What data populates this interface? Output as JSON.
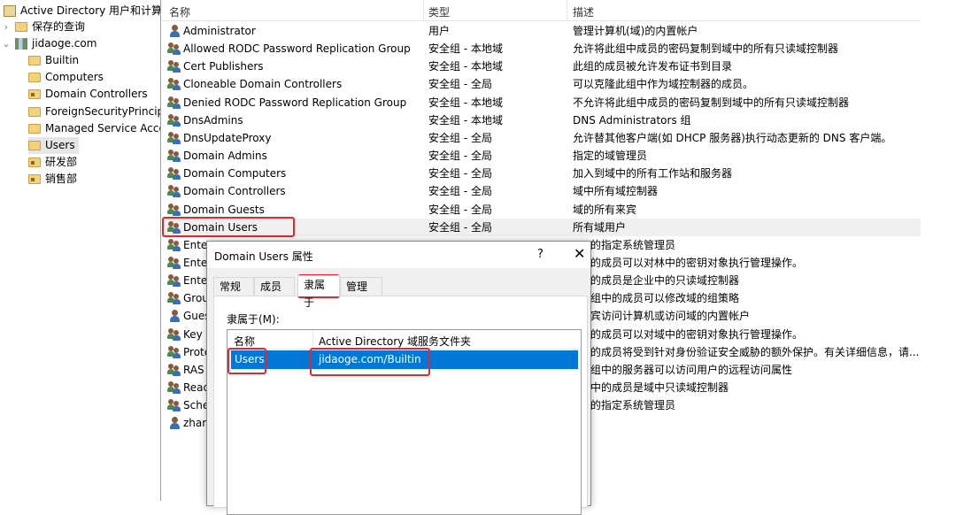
{
  "tree": {
    "root": "Active Directory 用户和计算机",
    "saved_queries": "保存的查询",
    "domain": "jidaoge.com",
    "children": [
      {
        "label": "Builtin",
        "ou": false
      },
      {
        "label": "Computers",
        "ou": false
      },
      {
        "label": "Domain Controllers",
        "ou": true
      },
      {
        "label": "ForeignSecurityPrincipals",
        "ou": false
      },
      {
        "label": "Managed Service Accounts",
        "ou": false
      },
      {
        "label": "Users",
        "ou": false,
        "selected": true
      },
      {
        "label": "研发部",
        "ou": true
      },
      {
        "label": "销售部",
        "ou": true
      }
    ]
  },
  "list": {
    "columns": [
      "名称",
      "类型",
      "描述"
    ],
    "rows": [
      {
        "name": "Administrator",
        "type": "用户",
        "desc": "管理计算机(域)的内置帐户",
        "icon": "user"
      },
      {
        "name": "Allowed RODC Password Replication Group",
        "type": "安全组 - 本地域",
        "desc": "允许将此组中成员的密码复制到域中的所有只读域控制器",
        "icon": "group"
      },
      {
        "name": "Cert Publishers",
        "type": "安全组 - 本地域",
        "desc": "此组的成员被允许发布证书到目录",
        "icon": "group"
      },
      {
        "name": "Cloneable Domain Controllers",
        "type": "安全组 - 全局",
        "desc": "可以克隆此组中作为域控制器的成员。",
        "icon": "group"
      },
      {
        "name": "Denied RODC Password Replication Group",
        "type": "安全组 - 本地域",
        "desc": "不允许将此组中成员的密码复制到域中的所有只读域控制器",
        "icon": "group"
      },
      {
        "name": "DnsAdmins",
        "type": "安全组 - 本地域",
        "desc": "DNS Administrators 组",
        "icon": "group"
      },
      {
        "name": "DnsUpdateProxy",
        "type": "安全组 - 全局",
        "desc": "允许替其他客户端(如 DHCP 服务器)执行动态更新的 DNS 客户端。",
        "icon": "group"
      },
      {
        "name": "Domain Admins",
        "type": "安全组 - 全局",
        "desc": "指定的域管理员",
        "icon": "group"
      },
      {
        "name": "Domain Computers",
        "type": "安全组 - 全局",
        "desc": "加入到域中的所有工作站和服务器",
        "icon": "group"
      },
      {
        "name": "Domain Controllers",
        "type": "安全组 - 全局",
        "desc": "域中所有域控制器",
        "icon": "group"
      },
      {
        "name": "Domain Guests",
        "type": "安全组 - 全局",
        "desc": "域的所有来宾",
        "icon": "group"
      },
      {
        "name": "Domain Users",
        "type": "安全组 - 全局",
        "desc": "所有域用户",
        "icon": "group",
        "selected": true
      },
      {
        "name": "Ente",
        "type": "",
        "desc": "的指定系统管理员",
        "icon": "group",
        "partial": true
      },
      {
        "name": "Ente",
        "type": "",
        "desc": "的成员可以对林中的密钥对象执行管理操作。",
        "icon": "group",
        "partial": true
      },
      {
        "name": "Ente",
        "type": "",
        "desc": "的成员是企业中的只读域控制器",
        "icon": "group",
        "partial": true
      },
      {
        "name": "Grou",
        "type": "",
        "desc": "组中的成员可以修改域的组策略",
        "icon": "group",
        "partial": true
      },
      {
        "name": "Gues",
        "type": "",
        "desc": "宾访问计算机或访问域的内置帐户",
        "icon": "user",
        "partial": true
      },
      {
        "name": "Key A",
        "type": "",
        "desc": "的成员可以对域中的密钥对象执行管理操作。",
        "icon": "group",
        "partial": true
      },
      {
        "name": "Prote",
        "type": "",
        "desc": "的成员将受到针对身份验证安全威胁的额外保护。有关详细信息，请...",
        "icon": "group",
        "partial": true
      },
      {
        "name": "RAS",
        "type": "",
        "desc": "组中的服务器可以访问用户的远程访问属性",
        "icon": "group",
        "partial": true
      },
      {
        "name": "Read",
        "type": "",
        "desc": "中的成员是域中只读域控制器",
        "icon": "group",
        "partial": true
      },
      {
        "name": "Sche",
        "type": "",
        "desc": "的指定系统管理员",
        "icon": "group",
        "partial": true
      },
      {
        "name": "zhan",
        "type": "",
        "desc": "",
        "icon": "user",
        "partial": true
      }
    ]
  },
  "dialog": {
    "title": "Domain Users 属性",
    "help": "?",
    "close": "✕",
    "tabs": [
      "常规",
      "成员",
      "隶属于",
      "管理者"
    ],
    "active_tab": "隶属于",
    "member_of_label": "隶属于(M):",
    "columns": [
      "名称",
      "Active Directory 域服务文件夹"
    ],
    "rows": [
      {
        "name": "Users",
        "folder": "jidaoge.com/Builtin",
        "selected": true
      }
    ]
  },
  "colors": {
    "selection": "#0078d7",
    "highlight_box": "#e8262a"
  }
}
